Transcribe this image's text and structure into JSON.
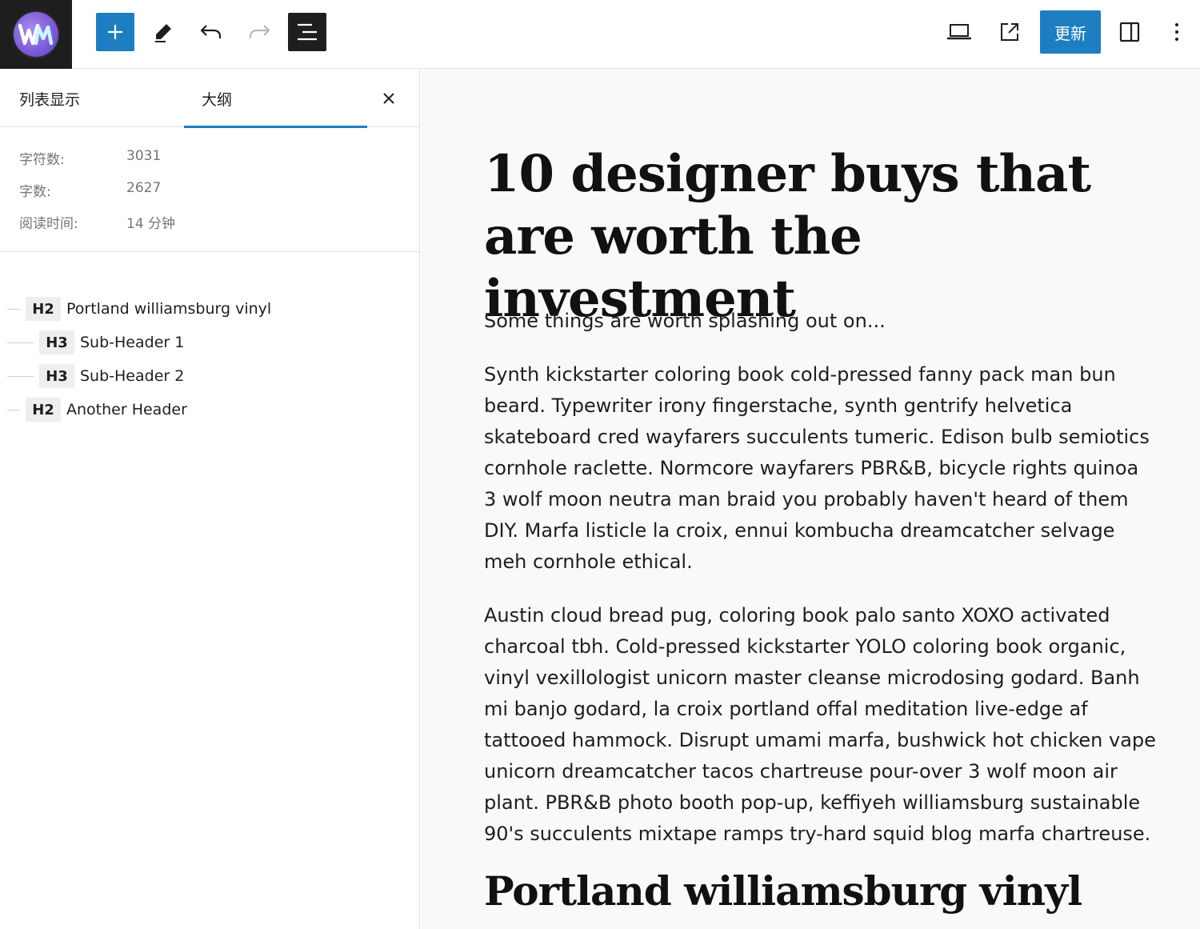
{
  "toolbar": {
    "logo_text": "WM",
    "add_icon": "plus-icon",
    "tools_icon": "pencil-icon",
    "undo_icon": "undo-icon",
    "redo_icon": "redo-icon",
    "listview_icon": "document-outline-icon",
    "preview_icon": "desktop-icon",
    "view_post_icon": "external-link-icon",
    "update_label": "更新",
    "settings_icon": "sidebar-icon",
    "more_icon": "more-vertical-icon"
  },
  "sidebar": {
    "tabs": [
      {
        "label": "列表显示"
      },
      {
        "label": "大纲"
      }
    ],
    "close_icon": "close-icon",
    "stats": [
      {
        "label": "字符数:",
        "value": "3031"
      },
      {
        "label": "字数:",
        "value": "2627"
      },
      {
        "label": "阅读时间:",
        "value": "14 分钟"
      }
    ],
    "outline": [
      {
        "level": "H2",
        "text": "Portland williamsburg vinyl"
      },
      {
        "level": "H3",
        "text": "Sub-Header 1"
      },
      {
        "level": "H3",
        "text": "Sub-Header 2"
      },
      {
        "level": "H2",
        "text": "Another Header"
      }
    ]
  },
  "editor": {
    "title": "10 designer buys that are worth the investment",
    "paragraphs": [
      "Some things are worth splashing out on...",
      "Synth kickstarter coloring book cold-pressed fanny pack man bun beard. Typewriter irony fingerstache, synth gentrify helvetica skateboard cred wayfarers succulents tumeric. Edison bulb semiotics cornhole raclette. Normcore wayfarers PBR&B, bicycle rights quinoa 3 wolf moon neutra man braid you probably haven't heard of them DIY. Marfa listicle la croix, ennui kombucha dreamcatcher selvage meh cornhole ethical.",
      "Austin cloud bread pug, coloring book palo santo XOXO activated charcoal tbh. Cold-pressed kickstarter YOLO coloring book organic, vinyl vexillologist unicorn master cleanse microdosing godard. Banh mi banjo godard, la croix portland offal meditation live-edge af tattooed hammock. Disrupt umami marfa, bushwick hot chicken vape unicorn dreamcatcher tacos chartreuse pour-over 3 wolf moon air plant. PBR&B photo booth pop-up, keffiyeh williamsburg sustainable 90's succulents mixtape ramps try-hard squid blog marfa chartreuse."
    ],
    "heading": "Portland williamsburg vinyl"
  },
  "colors": {
    "accent": "#1d7fc1",
    "dark": "#1e1e1e",
    "canvas": "#f9f9f9",
    "muted": "#757575"
  }
}
